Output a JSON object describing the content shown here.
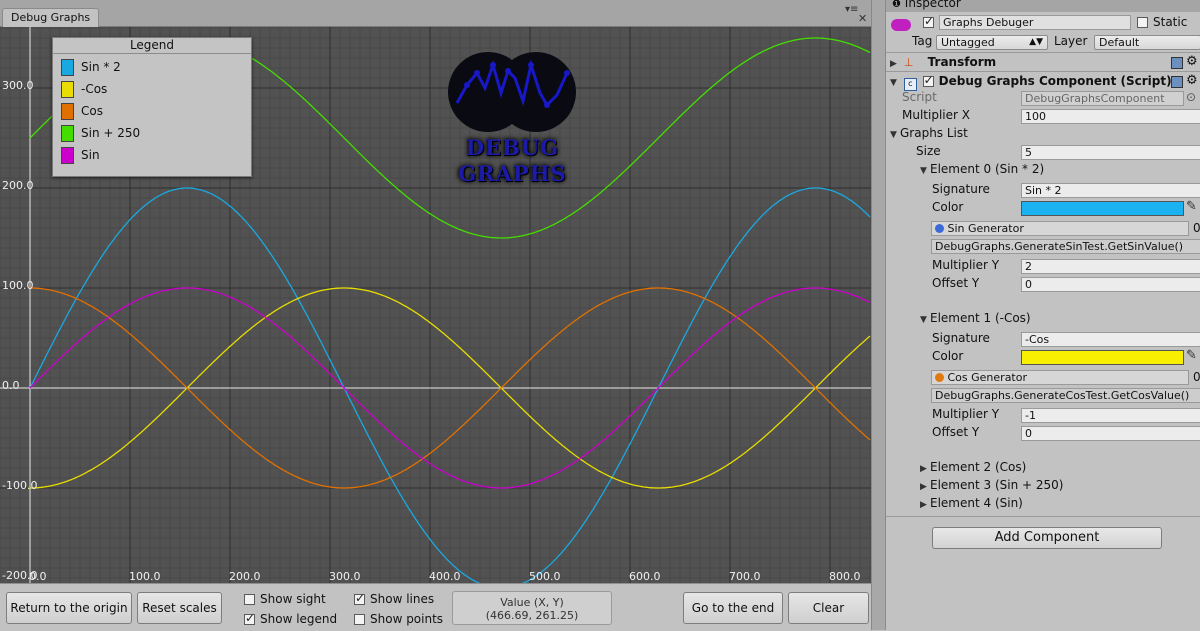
{
  "window": {
    "tab_label": "Debug Graphs",
    "menu_icon": "menu-icon",
    "close_icon": "close-icon"
  },
  "legend": {
    "title": "Legend",
    "items": [
      {
        "label": "Sin * 2",
        "color": "#1aa8e0"
      },
      {
        "label": "-Cos",
        "color": "#e8dc00"
      },
      {
        "label": "Cos",
        "color": "#e07000"
      },
      {
        "label": "Sin + 250",
        "color": "#44dd00"
      },
      {
        "label": "Sin",
        "color": "#cc00cc"
      }
    ]
  },
  "logo": {
    "text_line1": "DEBUG",
    "text_line2": "GRAPHS"
  },
  "chart_data": {
    "type": "line",
    "x_range": [
      0,
      840
    ],
    "y_range": [
      -200,
      345
    ],
    "xticks": [
      0,
      100,
      200,
      300,
      400,
      500,
      600,
      700,
      800
    ],
    "xtick_labels": [
      "0.0",
      "100.0",
      "200.0",
      "300.0",
      "400.0",
      "500.0",
      "600.0",
      "700.0",
      "800.0"
    ],
    "yticks": [
      300,
      200,
      100,
      0,
      -100,
      -200
    ],
    "ytick_labels": [
      "300.0",
      "200.0",
      "100.0",
      "0.0",
      "-100.0",
      "-200.0"
    ],
    "grid": true,
    "legend_position": "top-left",
    "period": 628.32,
    "series": [
      {
        "name": "Sin * 2",
        "color": "#1aa8e0",
        "amplitude": 200,
        "offset": 0,
        "phase": "sin"
      },
      {
        "name": "-Cos",
        "color": "#e8dc00",
        "amplitude": 100,
        "offset": 0,
        "phase": "-cos"
      },
      {
        "name": "Cos",
        "color": "#e07000",
        "amplitude": 100,
        "offset": 0,
        "phase": "cos"
      },
      {
        "name": "Sin + 250",
        "color": "#44dd00",
        "amplitude": 100,
        "offset": 250,
        "phase": "sin"
      },
      {
        "name": "Sin",
        "color": "#cc00cc",
        "amplitude": 100,
        "offset": 0,
        "phase": "sin"
      }
    ]
  },
  "toolbar": {
    "return_origin": "Return to the origin",
    "reset_scales": "Reset scales",
    "show_sight": "Show sight",
    "show_sight_checked": false,
    "show_legend": "Show legend",
    "show_legend_checked": true,
    "show_lines": "Show lines",
    "show_lines_checked": true,
    "show_points": "Show points",
    "show_points_checked": false,
    "value_title": "Value (X, Y)",
    "value_text": "(466.69, 261.25)",
    "go_to_end": "Go to the end",
    "clear": "Clear"
  },
  "inspector": {
    "tab_label": "Inspector",
    "object_name": "Graphs Debuger",
    "static_label": "Static",
    "tag_label": "Tag",
    "tag_value": "Untagged",
    "layer_label": "Layer",
    "layer_value": "Default",
    "transform_label": "Transform",
    "component_title": "Debug Graphs Component (Script)",
    "script_label": "Script",
    "script_value": "DebugGraphsComponent",
    "multiplier_x_label": "Multiplier X",
    "multiplier_x_value": "100",
    "graphs_list_label": "Graphs List",
    "size_label": "Size",
    "size_value": "5",
    "element0": {
      "title": "Element 0 (Sin * 2)",
      "signature_label": "Signature",
      "signature_value": "Sin * 2",
      "color_label": "Color",
      "color": "#1ab2f0",
      "generator": "Sin Generator",
      "generator_extra": "0",
      "method": "DebugGraphs.GenerateSinTest.GetSinValue()",
      "multiplier_y_label": "Multiplier Y",
      "multiplier_y_value": "2",
      "offset_y_label": "Offset Y",
      "offset_y_value": "0"
    },
    "element1": {
      "title": "Element 1 (-Cos)",
      "signature_label": "Signature",
      "signature_value": "-Cos",
      "color_label": "Color",
      "color": "#f8f000",
      "generator": "Cos Generator",
      "generator_extra": "0",
      "method": "DebugGraphs.GenerateCosTest.GetCosValue()",
      "multiplier_y_label": "Multiplier Y",
      "multiplier_y_value": "-1",
      "offset_y_label": "Offset Y",
      "offset_y_value": "0"
    },
    "element2": "Element 2 (Cos)",
    "element3": "Element 3 (Sin + 250)",
    "element4": "Element 4 (Sin)",
    "add_component": "Add Component"
  }
}
